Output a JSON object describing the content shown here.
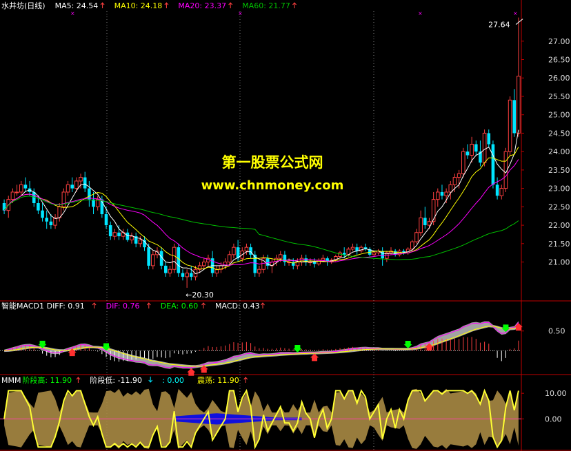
{
  "colors": {
    "up": "#ff4040",
    "down": "#00e5ff",
    "ma5": "#ffffff",
    "ma10": "#ffff00",
    "ma20": "#ff00ff",
    "ma60": "#00c000",
    "axis": "#c00000",
    "fill": "#a88a44",
    "grid": "#7f7f7f",
    "mmm": "#ffff33",
    "macdBar": "#ff4040"
  },
  "watermark": {
    "line1": "第一股票公式网",
    "line2": "www.chnmoney.com"
  },
  "chart_data": [
    {
      "type": "candlestick",
      "header": [
        {
          "text": "水井坊(日线)",
          "color": "#ffffff"
        },
        {
          "text": "MA5: 24.54",
          "color": "#ffffff",
          "arrow": "up"
        },
        {
          "text": "MA10: 24.18",
          "color": "#ffff00",
          "arrow": "up"
        },
        {
          "text": "MA20: 23.37",
          "color": "#ff00ff",
          "arrow": "up"
        },
        {
          "text": "MA60: 21.77",
          "color": "#00c000",
          "arrow": "up"
        }
      ],
      "ylim": [
        20.0,
        27.8
      ],
      "yticks": [
        "27.00",
        "26.50",
        "26.00",
        "25.50",
        "25.00",
        "24.50",
        "24.00",
        "23.50",
        "23.00",
        "22.50",
        "22.00",
        "21.50",
        "21.00"
      ],
      "annotations": [
        {
          "text": "27.64",
          "bar": 122,
          "value": 27.64,
          "pos": "left"
        },
        {
          "text": "←20.30",
          "bar": 43,
          "value": 20.3,
          "pos": "below"
        }
      ],
      "candles": [
        [
          22.6,
          22.7,
          22.3,
          22.4
        ],
        [
          22.4,
          22.8,
          22.2,
          22.7
        ],
        [
          22.7,
          23.0,
          22.6,
          22.9
        ],
        [
          22.9,
          23.1,
          22.8,
          22.9
        ],
        [
          22.9,
          23.2,
          22.8,
          23.1
        ],
        [
          23.1,
          23.3,
          22.9,
          23.0
        ],
        [
          23.0,
          23.2,
          22.8,
          22.9
        ],
        [
          22.9,
          23.0,
          22.5,
          22.6
        ],
        [
          22.6,
          22.8,
          22.3,
          22.4
        ],
        [
          22.4,
          22.6,
          22.1,
          22.2
        ],
        [
          22.2,
          22.4,
          21.9,
          22.1
        ],
        [
          22.1,
          22.3,
          21.9,
          22.0
        ],
        [
          22.0,
          22.3,
          21.9,
          22.2
        ],
        [
          22.2,
          22.6,
          22.1,
          22.5
        ],
        [
          22.5,
          23.0,
          22.4,
          22.9
        ],
        [
          22.9,
          23.2,
          22.8,
          23.1
        ],
        [
          23.1,
          23.3,
          22.9,
          23.0
        ],
        [
          23.0,
          23.3,
          22.9,
          23.2
        ],
        [
          23.2,
          23.4,
          23.0,
          23.3
        ],
        [
          23.3,
          23.45,
          22.9,
          23.0
        ],
        [
          23.0,
          23.2,
          22.5,
          22.7
        ],
        [
          22.7,
          22.9,
          22.3,
          22.5
        ],
        [
          22.5,
          22.8,
          22.4,
          22.7
        ],
        [
          22.7,
          22.8,
          22.2,
          22.3
        ],
        [
          22.3,
          22.5,
          21.9,
          22.0
        ],
        [
          22.0,
          22.1,
          21.6,
          21.7
        ],
        [
          21.7,
          21.9,
          21.6,
          21.8
        ],
        [
          21.8,
          22.0,
          21.6,
          21.7
        ],
        [
          21.7,
          21.9,
          21.6,
          21.8
        ],
        [
          21.8,
          21.9,
          21.55,
          21.6
        ],
        [
          21.6,
          21.8,
          21.5,
          21.7
        ],
        [
          21.7,
          21.8,
          21.4,
          21.5
        ],
        [
          21.5,
          21.7,
          21.4,
          21.6
        ],
        [
          21.6,
          21.7,
          21.3,
          21.4
        ],
        [
          21.4,
          21.5,
          20.8,
          20.9
        ],
        [
          20.9,
          21.3,
          20.8,
          21.2
        ],
        [
          21.2,
          21.4,
          21.1,
          21.3
        ],
        [
          21.3,
          21.4,
          20.8,
          20.9
        ],
        [
          20.9,
          21.0,
          20.6,
          20.7
        ],
        [
          20.7,
          20.9,
          20.6,
          20.8
        ],
        [
          20.8,
          21.5,
          20.7,
          21.4
        ],
        [
          21.4,
          21.5,
          20.6,
          20.7
        ],
        [
          20.7,
          20.8,
          20.5,
          20.6
        ],
        [
          20.6,
          20.8,
          20.3,
          20.7
        ],
        [
          20.7,
          20.9,
          20.5,
          20.6
        ],
        [
          20.6,
          20.9,
          20.5,
          20.8
        ],
        [
          20.8,
          21.0,
          20.7,
          20.9
        ],
        [
          20.9,
          21.1,
          20.8,
          21.0
        ],
        [
          21.0,
          21.2,
          20.9,
          21.1
        ],
        [
          21.1,
          21.3,
          20.6,
          20.7
        ],
        [
          20.7,
          20.9,
          20.6,
          20.8
        ],
        [
          20.8,
          21.0,
          20.7,
          20.9
        ],
        [
          20.9,
          21.1,
          20.8,
          21.0
        ],
        [
          21.0,
          21.3,
          20.9,
          21.2
        ],
        [
          21.2,
          21.5,
          21.1,
          21.4
        ],
        [
          21.4,
          21.6,
          21.0,
          21.1
        ],
        [
          21.1,
          21.4,
          21.0,
          21.3
        ],
        [
          21.3,
          21.5,
          21.2,
          21.4
        ],
        [
          21.4,
          21.5,
          21.1,
          21.2
        ],
        [
          21.2,
          21.3,
          20.6,
          20.7
        ],
        [
          20.7,
          20.9,
          20.6,
          20.8
        ],
        [
          20.8,
          21.2,
          20.7,
          21.1
        ],
        [
          21.1,
          21.2,
          20.8,
          20.9
        ],
        [
          20.9,
          21.1,
          20.7,
          21.0
        ],
        [
          21.0,
          21.2,
          20.9,
          21.1
        ],
        [
          21.1,
          21.3,
          21.0,
          21.2
        ],
        [
          21.2,
          21.3,
          20.9,
          21.0
        ],
        [
          21.0,
          21.1,
          20.9,
          21.0
        ],
        [
          21.0,
          21.1,
          20.8,
          20.9
        ],
        [
          20.9,
          21.1,
          20.8,
          21.0
        ],
        [
          21.0,
          21.2,
          20.9,
          21.1
        ],
        [
          21.1,
          21.2,
          20.9,
          21.0
        ],
        [
          21.0,
          21.1,
          20.9,
          21.0
        ],
        [
          21.0,
          21.1,
          20.85,
          20.95
        ],
        [
          20.95,
          21.1,
          20.9,
          21.05
        ],
        [
          21.05,
          21.2,
          21.0,
          21.1
        ],
        [
          21.1,
          21.15,
          20.9,
          21.0
        ],
        [
          21.0,
          21.1,
          20.95,
          21.05
        ],
        [
          21.05,
          21.2,
          21.0,
          21.15
        ],
        [
          21.15,
          21.3,
          21.1,
          21.25
        ],
        [
          21.25,
          21.4,
          21.1,
          21.2
        ],
        [
          21.2,
          21.4,
          21.15,
          21.35
        ],
        [
          21.35,
          21.5,
          21.3,
          21.4
        ],
        [
          21.4,
          21.5,
          21.2,
          21.3
        ],
        [
          21.3,
          21.45,
          21.25,
          21.4
        ],
        [
          21.4,
          21.5,
          21.3,
          21.35
        ],
        [
          21.35,
          21.4,
          21.15,
          21.2
        ],
        [
          21.2,
          21.3,
          21.15,
          21.25
        ],
        [
          21.25,
          21.35,
          21.2,
          21.3
        ],
        [
          21.3,
          21.4,
          20.9,
          21.1
        ],
        [
          21.1,
          21.3,
          21.0,
          21.25
        ],
        [
          21.25,
          21.4,
          21.2,
          21.3
        ],
        [
          21.3,
          21.35,
          21.15,
          21.2
        ],
        [
          21.2,
          21.35,
          21.15,
          21.3
        ],
        [
          21.3,
          21.35,
          21.2,
          21.25
        ],
        [
          21.25,
          21.4,
          21.2,
          21.35
        ],
        [
          21.35,
          21.6,
          21.3,
          21.55
        ],
        [
          21.55,
          21.9,
          21.5,
          21.8
        ],
        [
          21.8,
          22.4,
          21.7,
          22.2
        ],
        [
          22.2,
          22.5,
          21.9,
          22.0
        ],
        [
          22.0,
          22.2,
          21.9,
          22.1
        ],
        [
          22.1,
          22.9,
          22.0,
          22.7
        ],
        [
          22.7,
          23.0,
          22.5,
          22.9
        ],
        [
          22.9,
          23.1,
          22.7,
          22.8
        ],
        [
          22.8,
          23.0,
          22.6,
          22.9
        ],
        [
          22.9,
          23.2,
          22.7,
          23.1
        ],
        [
          23.1,
          23.4,
          22.9,
          23.3
        ],
        [
          23.3,
          23.5,
          23.0,
          23.4
        ],
        [
          23.4,
          24.1,
          23.3,
          24.0
        ],
        [
          24.0,
          24.2,
          23.8,
          23.9
        ],
        [
          23.9,
          24.4,
          23.7,
          24.2
        ],
        [
          24.2,
          24.3,
          23.9,
          24.0
        ],
        [
          24.0,
          24.3,
          23.6,
          23.7
        ],
        [
          23.7,
          24.6,
          23.6,
          24.5
        ],
        [
          24.5,
          24.6,
          24.1,
          24.2
        ],
        [
          24.2,
          24.3,
          23.0,
          23.1
        ],
        [
          23.1,
          23.3,
          22.7,
          22.8
        ],
        [
          22.8,
          23.1,
          22.7,
          23.0
        ],
        [
          23.0,
          24.1,
          22.9,
          24.0
        ],
        [
          24.0,
          25.5,
          23.9,
          25.4
        ],
        [
          25.4,
          25.7,
          24.4,
          24.5
        ],
        [
          24.5,
          27.64,
          24.4,
          26.05
        ]
      ]
    },
    {
      "type": "line",
      "header": [
        {
          "text": "智能MACD1",
          "color": "#ffffff"
        },
        {
          "text": "DIFF: 0.91",
          "color": "#ffffff",
          "arrow": "up"
        },
        {
          "text": "DIF: 0.76",
          "color": "#ff00ff",
          "arrow": "up"
        },
        {
          "text": "DEA: 0.60",
          "color": "#00ff00",
          "arrow": "up"
        },
        {
          "text": "MACD: 0.43",
          "color": "#ffffff",
          "arrow": "up"
        }
      ],
      "ylim": [
        -0.55,
        1.0
      ],
      "yticks": [
        "0.50"
      ]
    },
    {
      "type": "area",
      "header": [
        {
          "text": "MMM",
          "color": "#ffffff"
        },
        {
          "text": "阶段高: 11.90",
          "color": "#00ff00",
          "arrow": "up"
        },
        {
          "text": "阶段低: -11.90",
          "color": "#ffffff",
          "arrow": "down"
        },
        {
          "text": ": 0.00",
          "color": "#00ffff"
        },
        {
          "text": "震荡: 11.90",
          "color": "#ffff00",
          "arrow": "up"
        }
      ],
      "ylim": [
        -12.0,
        13.0
      ],
      "yticks": [
        "10.00",
        "0.00"
      ]
    }
  ]
}
